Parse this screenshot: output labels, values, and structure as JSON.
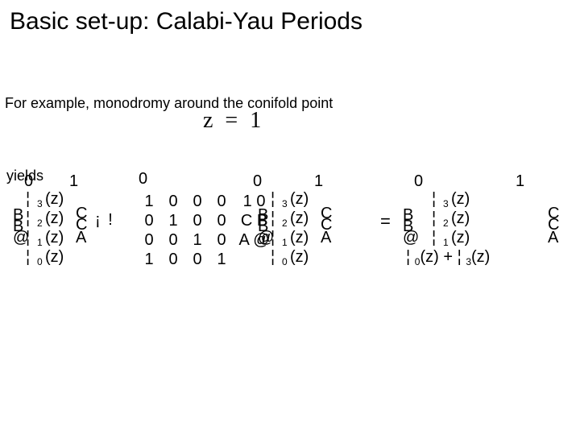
{
  "title": "Basic set-up: Calabi-Yau Periods",
  "for_line": "For example, monodromy around the conifold point",
  "zline": "z = 1",
  "yields": "yields",
  "arrow": "¡ !",
  "eq": "=",
  "lblock": {
    "head01": "0",
    "head1": "1",
    "rows": [
      {
        "pipe": "¦",
        "sub": "3",
        "z": "(z)"
      },
      {
        "pipe": "¦",
        "sub": "2",
        "z": "(z)",
        "brR": "C"
      },
      {
        "pipe": "¦",
        "sub": "1",
        "z": "(z)",
        "brR": "A"
      },
      {
        "pipe": "¦",
        "sub": "0",
        "z": "(z)"
      }
    ],
    "big": {
      "B": "B",
      "B2": "B",
      "At": "@",
      "Cc": "C",
      "Cc2": "C",
      "Aa": "A"
    }
  },
  "matrix": {
    "head0": "0",
    "rows": [
      [
        "1",
        "0",
        "0",
        "0"
      ],
      [
        "0",
        "1",
        "0",
        "0"
      ],
      [
        "0",
        "0",
        "1",
        "0"
      ],
      [
        "1",
        "0",
        "0",
        "1"
      ]
    ],
    "rhead": [
      "1 0",
      "C B",
      "A @"
    ],
    "rcol0": [
      "0",
      "0",
      "0"
    ]
  },
  "rblock": {
    "head01": "0",
    "head1": "1",
    "rows": [
      {
        "pipe": "¦",
        "sub": "3",
        "z": "(z)"
      },
      {
        "pipe": "¦",
        "sub": "2",
        "z": "(z)",
        "brR": "C"
      },
      {
        "pipe": "¦",
        "sub": "1",
        "z": "(z)",
        "brR": "A"
      }
    ],
    "row4": "¦ 0(z) + ¦ 3(z)",
    "big": {
      "B": "B",
      "B2": "B",
      "At": "@",
      "Cc": "C",
      "Cc2": "C",
      "Aa": "A"
    }
  }
}
